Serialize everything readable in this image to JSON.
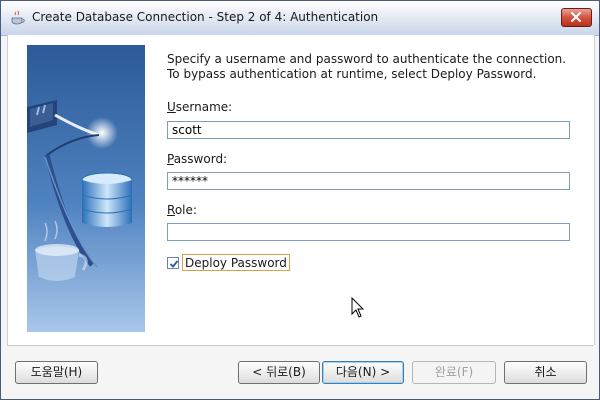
{
  "window": {
    "title": "Create Database Connection - Step 2 of 4: Authentication"
  },
  "content": {
    "description": "Specify a username and password to authenticate the connection. To bypass authentication at runtime, select Deploy Password.",
    "username": {
      "label_mnemonic": "U",
      "label_rest": "sername:",
      "value": "scott"
    },
    "password": {
      "label_mnemonic": "P",
      "label_rest": "assword:",
      "value": "******"
    },
    "role": {
      "label_mnemonic": "R",
      "label_rest": "ole:",
      "value": ""
    },
    "deploy_password": {
      "label": "Deploy Password",
      "checked": true
    }
  },
  "buttons": {
    "help": "도움말(H)",
    "back": "< 뒤로(B)",
    "next": "다음(N) >",
    "finish": "완료(F)",
    "cancel": "취소"
  },
  "colors": {
    "title_gradient_bottom": "#c9d6ea",
    "close_button": "#d4533f",
    "side_panel_blue": "#3f6fb0",
    "default_button_border": "#3c7fb1"
  }
}
